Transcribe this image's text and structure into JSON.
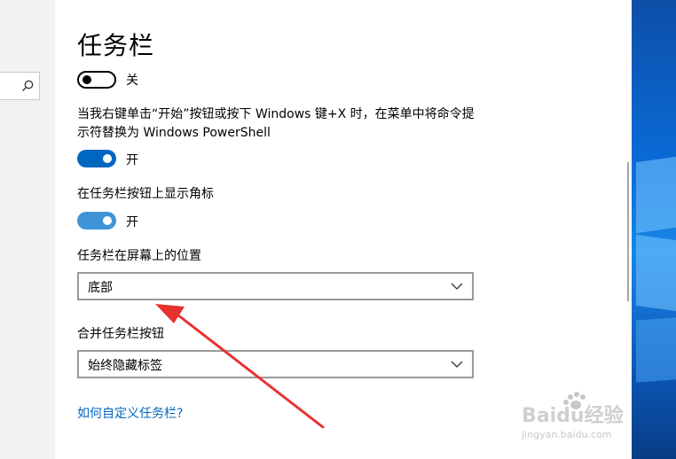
{
  "page": {
    "title": "任务栏"
  },
  "toggles": {
    "lock_taskbar_state": "关",
    "powershell_label": "当我右键单击“开始”按钮或按下 Windows 键+X 时，在菜单中将命令提示符替换为 Windows PowerShell",
    "powershell_state": "开",
    "badges_label": "在任务栏按钮上显示角标",
    "badges_state": "开"
  },
  "position": {
    "label": "任务栏在屏幕上的位置",
    "value": "底部"
  },
  "combine": {
    "label": "合并任务栏按钮",
    "value": "始终隐藏标签"
  },
  "help_link": "如何自定义任务栏?",
  "watermark": {
    "brand": "Baidu经验",
    "url": "jingyan.baidu.com"
  },
  "colors": {
    "accent": "#0067c0",
    "annotation_arrow": "#e8312f"
  },
  "icons": {
    "search": "search-icon",
    "chevron": "chevron-down-icon"
  }
}
